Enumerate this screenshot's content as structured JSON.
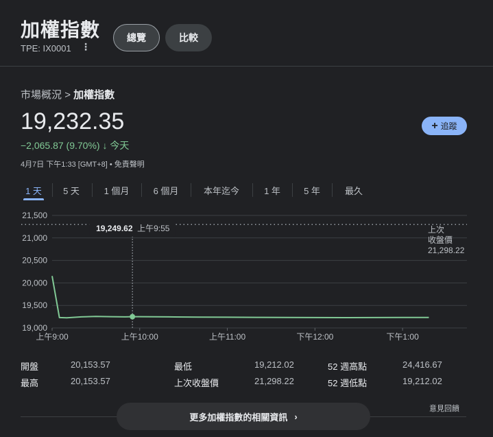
{
  "header": {
    "title": "加權指數",
    "ticker": "TPE: IX0001",
    "more_icon": "⋮",
    "tabs": [
      "總覽",
      "比較"
    ]
  },
  "breadcrumb": {
    "parent": "市場概況",
    "separator": ">",
    "current": "加權指數"
  },
  "quote": {
    "price": "19,232.35",
    "change": "−2,065.87 (9.70%)",
    "arrow": "↓",
    "period": "今天",
    "timestamp": "4月7日 下午1:33 [GMT+8] • 免責聲明"
  },
  "follow_button": {
    "icon": "+",
    "label": "追蹤"
  },
  "range_tabs": [
    "1 天",
    "5 天",
    "1 個月",
    "6 個月",
    "本年迄今",
    "1 年",
    "5 年",
    "最久"
  ],
  "colors": {
    "line": "#81c995",
    "accent": "#8ab4f8",
    "background": "#202124"
  },
  "chart_data": {
    "type": "line",
    "y_ticks": [
      "21,500",
      "21,000",
      "20,500",
      "20,000",
      "19,500",
      "19,000"
    ],
    "x_ticks": [
      "上午9:00",
      "上午10:00",
      "上午11:00",
      "下午12:00",
      "下午1:00"
    ],
    "ylim": [
      19000,
      21500
    ],
    "xlim_minutes": [
      0,
      270
    ],
    "previous_close": {
      "label_line1": "上次",
      "label_line2": "收盤價",
      "value_label": "21,298.22",
      "value": 21298.22
    },
    "tooltip": {
      "value": "19,249.62",
      "time": "上午9:55"
    },
    "hover_point": {
      "x": 55,
      "y": 19249.62
    },
    "series": [
      {
        "x": [
          0,
          5,
          10,
          20,
          30,
          40,
          50,
          55,
          60,
          80,
          100,
          120,
          140,
          160,
          180,
          200,
          220,
          240,
          258
        ],
        "y": [
          20153.57,
          19230,
          19225,
          19245,
          19255,
          19250,
          19245,
          19249.62,
          19250,
          19245,
          19240,
          19238,
          19235,
          19232,
          19230,
          19228,
          19230,
          19232,
          19232.35
        ]
      }
    ]
  },
  "stats": [
    {
      "label": "開盤",
      "value": "20,153.57"
    },
    {
      "label": "最高",
      "value": "20,153.57"
    },
    {
      "label": "最低",
      "value": "19,212.02"
    },
    {
      "label": "上次收盤價",
      "value": "21,298.22"
    },
    {
      "label": "52 週高點",
      "value": "24,416.67"
    },
    {
      "label": "52 週低點",
      "value": "19,212.02"
    }
  ],
  "feedback": "意見回饋",
  "more_button": {
    "label": "更多加權指數的相關資訊",
    "icon": "›"
  }
}
